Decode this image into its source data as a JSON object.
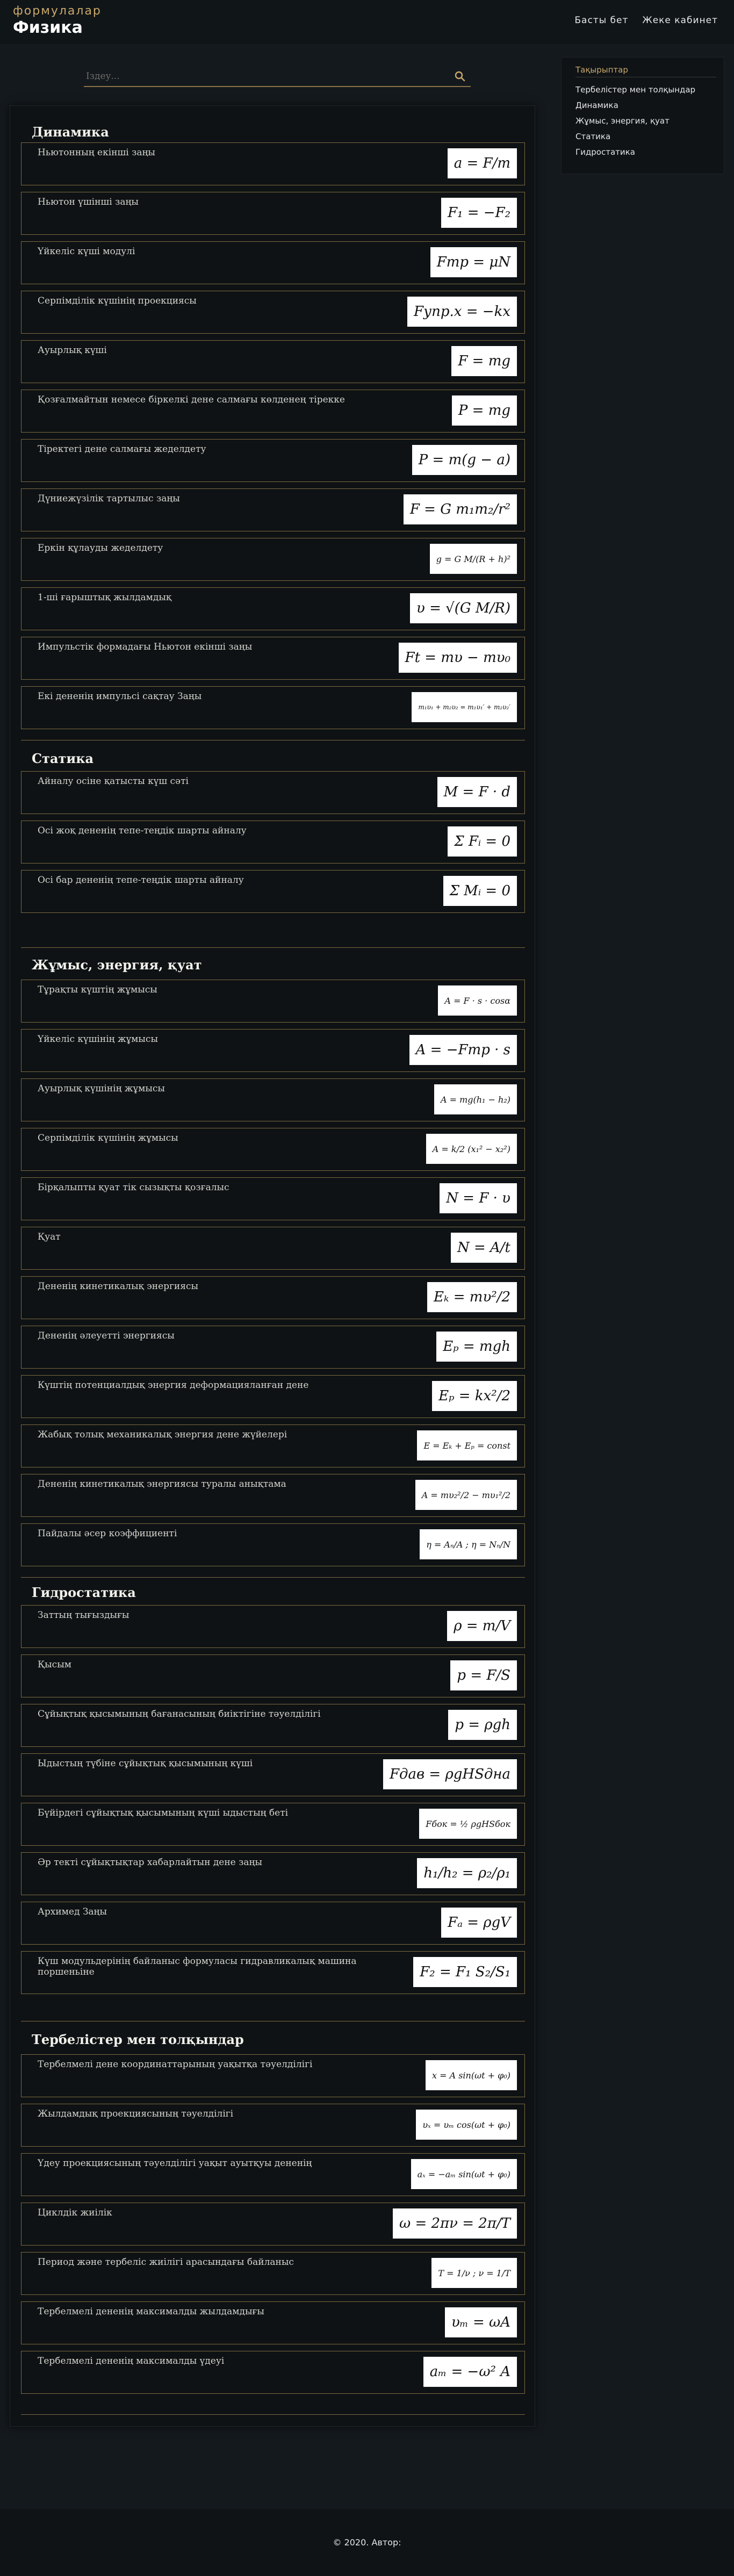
{
  "header": {
    "brand_sub": "формулалар",
    "brand_title": "Физика",
    "nav": [
      "Басты бет",
      "Жеке кабинет"
    ]
  },
  "search": {
    "placeholder": "Іздеу..."
  },
  "sidebar": {
    "title": "Тақырыптар",
    "items": [
      "Тербелістер мен толқындар",
      "Динамика",
      "Жұмыс, энергия, қуат",
      "Статика",
      "Гидростатика"
    ]
  },
  "sections": [
    {
      "title": "Динамика",
      "cards": [
        {
          "label": "Ньютонның екінші заңы",
          "formula": "a = F/m"
        },
        {
          "label": "Ньютон үшінші заңы",
          "formula": "F₁ = −F₂"
        },
        {
          "label": "Үйкеліс күші модулі",
          "formula": "Fтр = μN"
        },
        {
          "label": "Серпімділік күшінің проекциясы",
          "formula": "Fупр.x = −kx"
        },
        {
          "label": "Ауырлық күші",
          "formula": "F = mg"
        },
        {
          "label": "Қозғалмайтын немесе біркелкі дене салмағы көлденең тірекке",
          "formula": "P = mg"
        },
        {
          "label": "Тіректегі дене салмағы жеделдету",
          "formula": "P = m(g − a)"
        },
        {
          "label": "Дүниежүзілік тартылыс заңы",
          "formula": "F = G m₁m₂/r²"
        },
        {
          "label": "Еркін құлауды жеделдету",
          "formula": "g = G M/(R + h)²"
        },
        {
          "label": "1-ші ғарыштық жылдамдық",
          "formula": "υ = √(G M/R)"
        },
        {
          "label": "Импульстік формадағы Ньютон екінші заңы",
          "formula": "Ft = mυ − mυ₀"
        },
        {
          "label": "Екі дененің импульсі сақтау Заңы",
          "formula": "m₁υ₁ + m₂υ₂ = m₁υ₁′ + m₂υ₂′"
        }
      ]
    },
    {
      "title": "Статика",
      "cards": [
        {
          "label": "Айналу осіне қатысты күш сәті",
          "formula": "M = F · d"
        },
        {
          "label": "Осі жоқ дененің тепе-теңдік шарты айналу",
          "formula": "Σ Fᵢ = 0"
        },
        {
          "label": "Осі бар дененің тепе-теңдік шарты айналу",
          "formula": "Σ Mᵢ = 0"
        }
      ]
    },
    {
      "title": "Жұмыс, энергия, қуат",
      "cards": [
        {
          "label": "Тұрақты күштің жұмысы",
          "formula": "A = F · s · cosα"
        },
        {
          "label": "Үйкеліс күшінің жұмысы",
          "formula": "A = −Fтр · s"
        },
        {
          "label": "Ауырлық күшінің жұмысы",
          "formula": "A = mg(h₁ − h₂)"
        },
        {
          "label": "Серпімділік күшінің жұмысы",
          "formula": "A = k/2 (x₁² − x₂²)"
        },
        {
          "label": "Бірқалыпты қуат тік сызықты қозғалыс",
          "formula": "N = F · υ"
        },
        {
          "label": "Қуат",
          "formula": "N = A/t"
        },
        {
          "label": "Дененің кинетикалық энергиясы",
          "formula": "Eₖ = mυ²/2"
        },
        {
          "label": "Дененің әлеуетті энергиясы",
          "formula": "Eₚ = mgh"
        },
        {
          "label": "Күштің потенциалдық энергия деформацияланған дене",
          "formula": "Eₚ = kx²/2"
        },
        {
          "label": "Жабық толық механикалық энергия дене жүйелері",
          "formula": "E = Eₖ + Eₚ = const"
        },
        {
          "label": "Дененің кинетикалық энергиясы туралы анықтама",
          "formula": "A = mυ₂²/2 − mυ₁²/2"
        },
        {
          "label": "Пайдалы әсер коэффициенті",
          "formula": "η = Aₙ/A ; η = Nₙ/N"
        }
      ]
    },
    {
      "title": "Гидростатика",
      "cards": [
        {
          "label": "Заттың тығыздығы",
          "formula": "ρ = m/V"
        },
        {
          "label": "Қысым",
          "formula": "p = F/S"
        },
        {
          "label": "Сұйықтық қысымының бағанасының биіктігіне тәуелділігі",
          "formula": "p = ρgh"
        },
        {
          "label": "Ыдыстың түбіне сұйықтық қысымының күші",
          "formula": "Fдав = ρgHSдна"
        },
        {
          "label": "Бүйірдегі сұйықтық қысымының күші ыдыстың беті",
          "formula": "Fбок = ½ ρgHSбок"
        },
        {
          "label": "Әр текті сұйықтықтар хабарлайтын дене заңы",
          "formula": "h₁/h₂ = ρ₂/ρ₁"
        },
        {
          "label": "Архимед Заңы",
          "formula": "Fₐ = ρgV"
        },
        {
          "label": "Күш модульдерінің байланыс формуласы гидравликалық машина поршеньіне",
          "formula": "F₂ = F₁ S₂/S₁"
        }
      ]
    },
    {
      "title": "Тербелістер мен толқындар",
      "cards": [
        {
          "label": "Тербелмелі дене координаттарының уақытқа тәуелділігі",
          "formula": "x = A sin(ωt + φ₀)"
        },
        {
          "label": "Жылдамдық проекциясының тәуелділігі",
          "formula": "υₓ = υₘ cos(ωt + φ₀)"
        },
        {
          "label": "Үдеу проекциясының тәуелділігі уақыт ауытқуы дененің",
          "formula": "aₓ = −aₘ sin(ωt + φ₀)"
        },
        {
          "label": "Циклдік жиілік",
          "formula": "ω = 2πν = 2π/T"
        },
        {
          "label": "Период және тербеліс жиілігі арасындағы байланыс",
          "formula": "T = 1/ν ; ν = 1/T"
        },
        {
          "label": "Тербелмелі дененің максималды жылдамдығы",
          "formula": "υₘ = ωA"
        },
        {
          "label": "Тербелмелі дененің максималды үдеуі",
          "formula": "aₘ = −ω² A"
        }
      ]
    }
  ],
  "footer": {
    "text": "© 2020. Автор:"
  }
}
